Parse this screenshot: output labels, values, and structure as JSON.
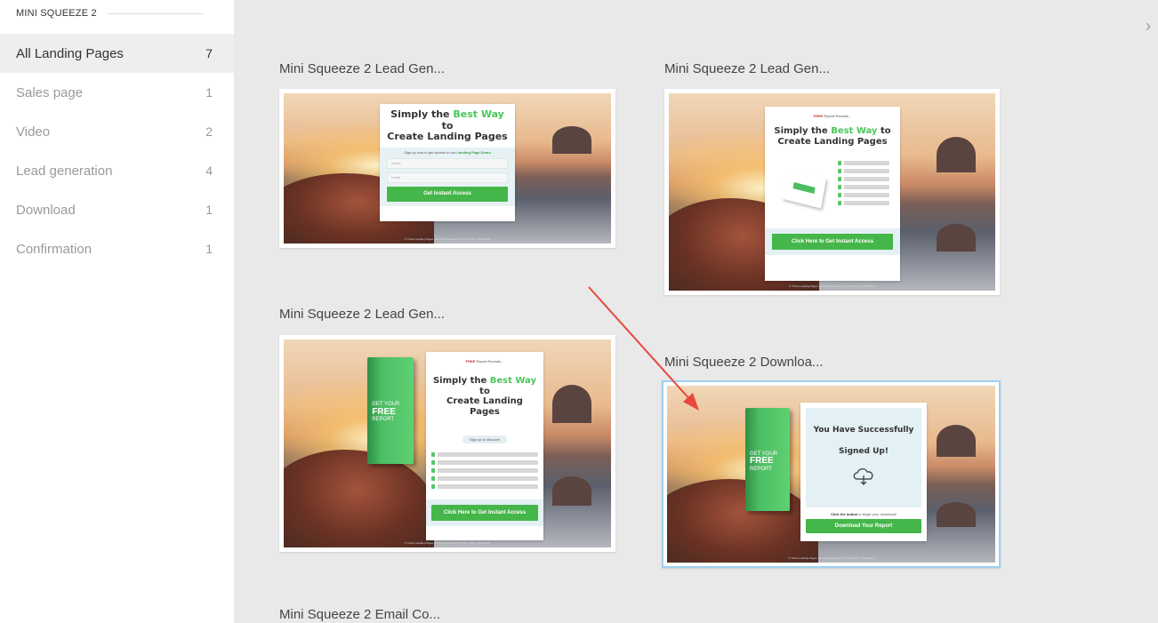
{
  "sidebar": {
    "header": "MINI SQUEEZE 2",
    "items": [
      {
        "label": "All Landing Pages",
        "count": "7"
      },
      {
        "label": "Sales page",
        "count": "1"
      },
      {
        "label": "Video",
        "count": "2"
      },
      {
        "label": "Lead generation",
        "count": "4"
      },
      {
        "label": "Download",
        "count": "1"
      },
      {
        "label": "Confirmation",
        "count": "1"
      }
    ]
  },
  "main": {
    "close_icon": "close-icon",
    "cards": [
      {
        "title": "Mini Squeeze 2 Lead Gen...",
        "selected": false
      },
      {
        "title": "Mini Squeeze 2 Lead Gen...",
        "selected": false
      },
      {
        "title": "Mini Squeeze 2 Lead Gen...",
        "selected": false
      },
      {
        "title": "Mini Squeeze 2 Downloa...",
        "selected": true
      },
      {
        "title": "Mini Squeeze 2 Email Co...",
        "selected": false
      }
    ]
  },
  "previews": {
    "p1": {
      "title_pre": "Simply the ",
      "title_hl": "Best Way",
      "title_post": " to",
      "title_line2": "Create Landing Pages",
      "sub_pre": "Sign up now to get access to our ",
      "sub_bold": "Landing Page Demo",
      "field1": "Name",
      "field2": "Email",
      "button": "Get Instant Access",
      "footer": "© Thrive Landing Pages. All rights Reserved | Privacy Policy | Disclaimer"
    },
    "p2": {
      "top_bold": "FREE",
      "top_rest": " Report Reveals...",
      "title_pre": "Simply the ",
      "title_hl": "Best Way",
      "title_post": " to",
      "title_line2": "Create Landing Pages",
      "button": "Click Here to Get Instant Access",
      "footer": "© Thrive Landing Pages. All rights Reserved | Privacy Policy | Disclaimer"
    },
    "p3": {
      "top_bold": "FREE",
      "top_rest": " Report Reveals...",
      "title_pre": "Simply the ",
      "title_hl": "Best Way",
      "title_post": " to",
      "title_line2": "Create Landing Pages",
      "pill": "Sign up to discover",
      "button": "Click Here to Get Instant Access",
      "book_l1": "GET YOUR",
      "book_l2": "FREE",
      "book_l3": "REPORT",
      "footer": "© Thrive Landing Pages. All rights Reserved | Privacy Policy | Disclaimer"
    },
    "p4": {
      "title_line1": "You Have Successfully",
      "title_line2": "Signed Up!",
      "sub_bold": "Click the button",
      "sub_rest": " to begin your download!",
      "button": "Download Your Report",
      "book_l1": "GET YOUR",
      "book_l2": "FREE",
      "book_l3": "REPORT",
      "footer": "© Thrive Landing Pages. All rights Reserved | Privacy Policy | Disclaimer"
    }
  },
  "colors": {
    "accent_green": "#45b649",
    "highlight_green": "#4cc65a",
    "selection_border": "#9fd0ef",
    "annotation_arrow": "#e8473c"
  }
}
